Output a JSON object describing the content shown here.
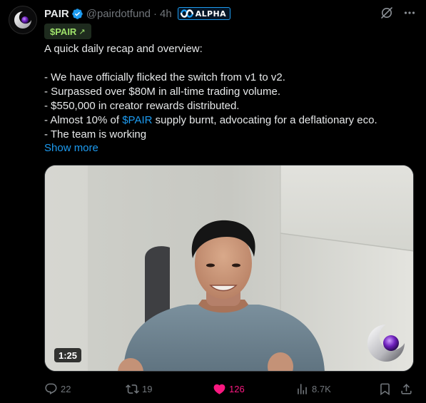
{
  "tweet": {
    "display_name": "PAIR",
    "handle": "@pairdotfund",
    "separator": "·",
    "time": "4h",
    "badge_label": "ALPHA",
    "cashtag_chip": "$PAIR",
    "cashtag_chip_arrow": "↗",
    "body": {
      "line1": "A quick daily recap and overview:",
      "line2": "- We have officially flicked the switch from v1 to v2.",
      "line3": "- Surpassed over $80M in all-time trading volume.",
      "line4": "- $550,000 in creator rewards distributed.",
      "line5_before": "- Almost 10% of ",
      "line5_link": "$PAIR",
      "line5_after": " supply burnt, advocating for a deflationary eco.",
      "line6": "- The team is working"
    },
    "show_more": "Show more",
    "video_duration": "1:25"
  },
  "actions": {
    "replies": "22",
    "reposts": "19",
    "likes": "126",
    "views": "8.7K"
  },
  "colors": {
    "accent": "#1d9bf0",
    "like": "#f91880",
    "muted": "#71767b",
    "chip_text": "#9ee26a"
  },
  "icons": {
    "grok": "grok-icon",
    "more": "more-icon",
    "reply": "reply-icon",
    "repost": "repost-icon",
    "like": "heart-icon",
    "views": "views-icon",
    "bookmark": "bookmark-icon",
    "share": "share-icon"
  }
}
